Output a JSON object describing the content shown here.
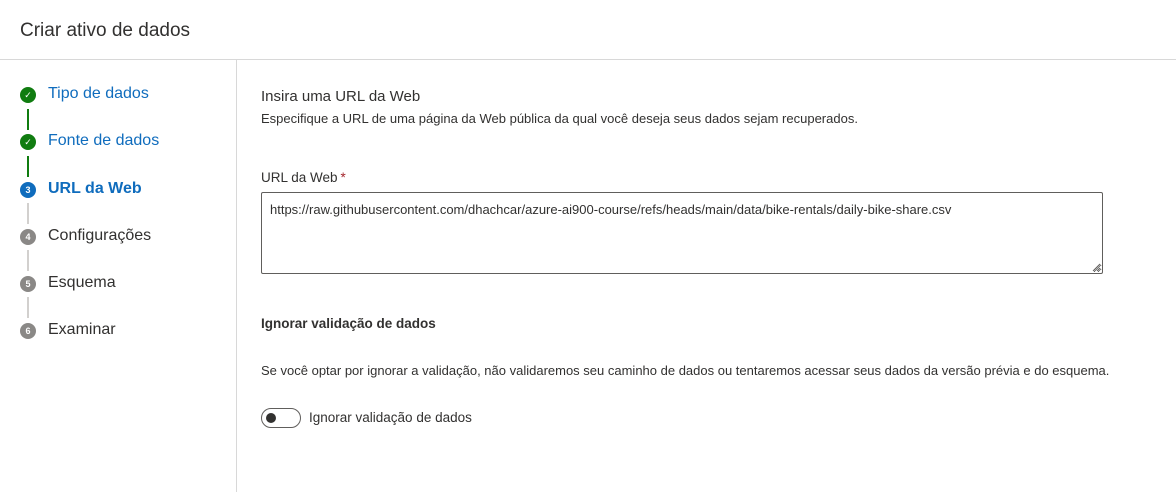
{
  "header": {
    "title": "Criar ativo de dados"
  },
  "steps": [
    {
      "marker": "✓",
      "label": "Tipo de dados",
      "state": "done"
    },
    {
      "marker": "✓",
      "label": "Fonte de dados",
      "state": "done"
    },
    {
      "marker": "3",
      "label": "URL da Web",
      "state": "current"
    },
    {
      "marker": "4",
      "label": "Configurações",
      "state": "pending"
    },
    {
      "marker": "5",
      "label": "Esquema",
      "state": "pending"
    },
    {
      "marker": "6",
      "label": "Examinar",
      "state": "pending"
    }
  ],
  "main": {
    "section_title": "Insira uma URL da Web",
    "section_description": "Especifique a URL de uma página da Web pública da qual você deseja seus dados sejam recuperados.",
    "url_field": {
      "label": "URL da Web",
      "required_marker": "*",
      "value": "https://raw.githubusercontent.com/dhachcar/azure-ai900-course/refs/heads/main/data/bike-rentals/daily-bike-share.csv"
    },
    "ignore_validation": {
      "title": "Ignorar validação de dados",
      "description": "Se você optar por ignorar a validação, não validaremos seu caminho de dados ou tentaremos acessar seus dados da versão prévia e do esquema.",
      "toggle_label": "Ignorar validação de dados",
      "toggle_on": false
    }
  },
  "colors": {
    "done": "#107c10",
    "current": "#0f6cbd",
    "pending": "#8a8886",
    "required": "#a4262c"
  }
}
